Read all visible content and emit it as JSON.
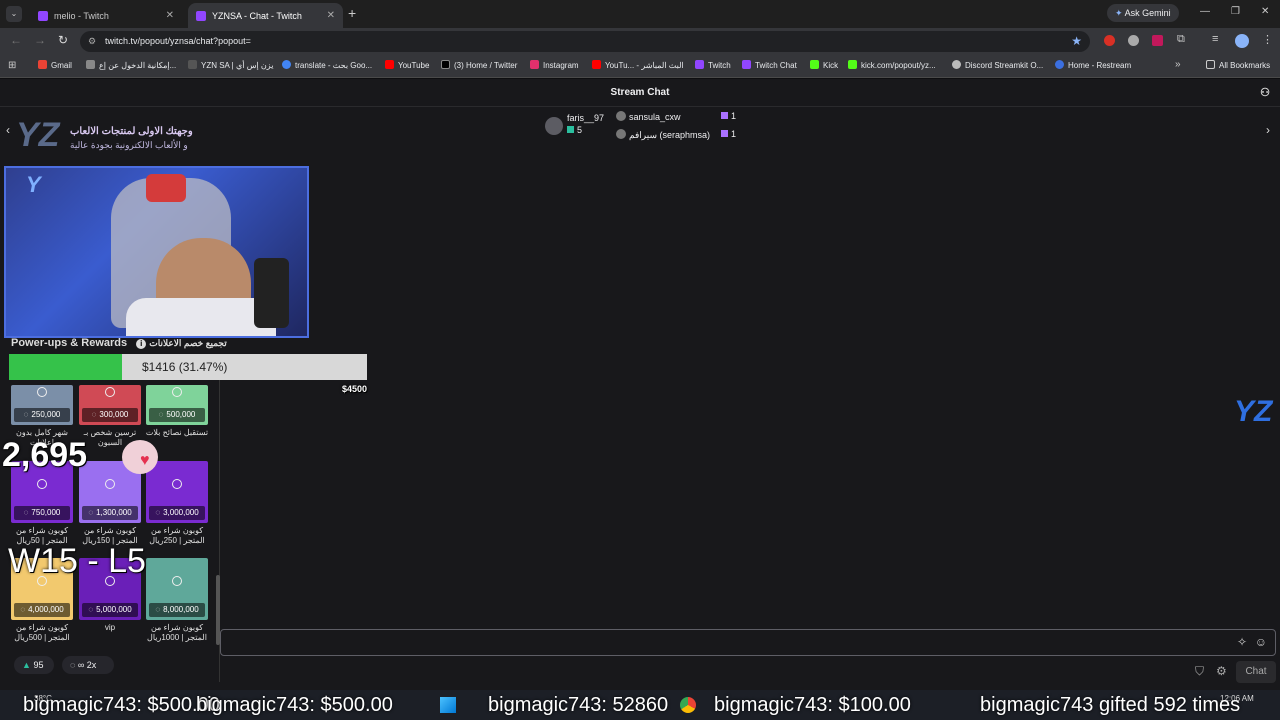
{
  "browser": {
    "tabs": [
      {
        "title": "melio - Twitch",
        "active": false
      },
      {
        "title": "YZNSA - Chat - Twitch",
        "active": true
      }
    ],
    "new_tab": "+",
    "ask_gemini": "Ask Gemini",
    "url": "twitch.tv/popout/yznsa/chat?popout=",
    "bookmarks": [
      "Gmail",
      "إمكانية الدخول عن إع...",
      "YZN SA | يزن إس أي",
      "translate - بحث Goo...",
      "YouTube",
      "(3) Home / Twitter",
      "Instagram",
      "YouTu... - البث المباشر",
      "Twitch",
      "Twitch Chat",
      "Kick",
      "kick.com/popout/yz...",
      "Discord Streamkit O...",
      "Home - Restream"
    ],
    "all_bookmarks": "All Bookmarks"
  },
  "chat": {
    "header_title": "Stream Chat",
    "leaderboard": [
      {
        "name": "faris__97",
        "count": "5"
      },
      {
        "name": "sansula_cxw",
        "count": "1"
      },
      {
        "name": "سيرافم (seraphmsa)",
        "count": "1"
      }
    ],
    "send_label": "Chat"
  },
  "overlay": {
    "banner_line1": "وجهتك الاولى لمنتجات الالعاب",
    "banner_line2": "و الألعاب الالكترونية بجودة عالية",
    "powerups_title": "Power-ups & Rewards",
    "goal_label": "تجميع خصم الاعلانات",
    "goal_current": "$1416 (31.47%)",
    "goal_progress": 0.3147,
    "goal_min": "$0",
    "goal_max": "$4500",
    "viewers_count": "2,695",
    "record": "W15 - L5",
    "rewards": [
      {
        "cost": "250,000",
        "title": "شهر كامل بدون إعلانات",
        "color": "#7b8fa8"
      },
      {
        "cost": "300,000",
        "title": "ترسين شخص بـ السبون",
        "color": "#d04a55"
      },
      {
        "cost": "500,000",
        "title": "تستقبل نصائح بلات",
        "color": "#7fd39a"
      },
      {
        "cost": "750,000",
        "title": "كوبون شراء من المتجر | 50ريال",
        "color": "#7a2bd1"
      },
      {
        "cost": "1,300,000",
        "title": "كوبون شراء من المتجر | 150ريال",
        "color": "#9a6ff0"
      },
      {
        "cost": "3,000,000",
        "title": "كوبون شراء من المتجر | 250ريال",
        "color": "#7a2bd1"
      },
      {
        "cost": "4,000,000",
        "title": "كوبون شراء من المتجر | 500ريال",
        "color": "#f2c96e"
      },
      {
        "cost": "5,000,000",
        "title": "vip",
        "color": "#6a1fb8"
      },
      {
        "cost": "8,000,000",
        "title": "كوبون شراء من المتجر | 1000ريال",
        "color": "#5fa89a"
      }
    ],
    "points_value": "95",
    "multiplier": "2x"
  },
  "ticker": [
    "bigmagic743: $500.00",
    "bigmagic743: $500.00",
    "bigmagic743: 52860",
    "bigmagic743: $100.00",
    "bigmagic743 gifted 592 times"
  ],
  "taskbar": {
    "weather": "38°C",
    "time": "12:06 AM"
  }
}
